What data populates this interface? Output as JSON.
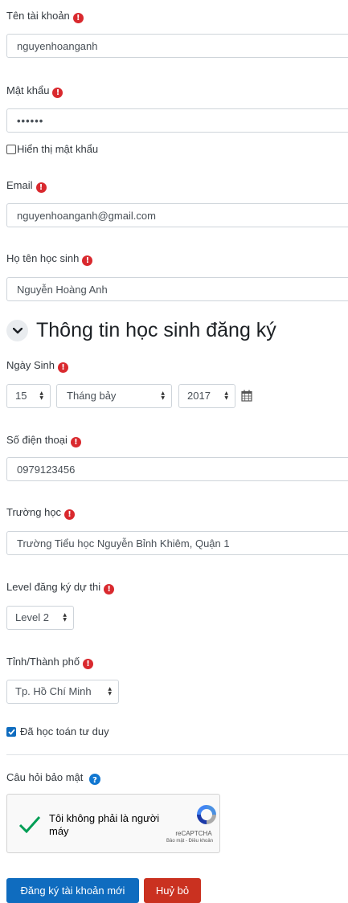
{
  "fields": {
    "username": {
      "label": "Tên tài khoản",
      "value": "nguyenhoanganh"
    },
    "password": {
      "label": "Mật khẩu",
      "value": "••••••",
      "show_label": "Hiển thị mật khẩu"
    },
    "email": {
      "label": "Email",
      "value": "nguyenhoanganh@gmail.com"
    },
    "student_name": {
      "label": "Họ tên học sinh",
      "value": "Nguyễn Hoàng Anh"
    }
  },
  "student_section": {
    "title": "Thông tin học sinh đăng ký",
    "birthdate": {
      "label": "Ngày Sinh",
      "day": "15",
      "month": "Tháng bảy",
      "year": "2017"
    },
    "phone": {
      "label": "Số điện thoại",
      "value": "0979123456"
    },
    "school": {
      "label": "Trường học",
      "value": "Trường Tiểu học Nguyễn Bỉnh Khiêm, Quận 1"
    },
    "level": {
      "label": "Level đăng ký dự thi",
      "value": "Level 2"
    },
    "city": {
      "label": "Tỉnh/Thành phố",
      "value": "Tp. Hồ Chí Minh"
    },
    "studied_math": {
      "label": "Đã học toán tư duy",
      "checked": true
    }
  },
  "security": {
    "label": "Câu hỏi bảo mật",
    "captcha_text": "Tôi không phải là người máy",
    "captcha_brand": "reCAPTCHA",
    "captcha_links": "Bảo mật - Điều khoản"
  },
  "actions": {
    "submit": "Đăng ký tài khoản mới",
    "cancel": "Huỷ bỏ"
  },
  "colors": {
    "required": "#d9292e",
    "primary": "#0f6cbf",
    "danger": "#ca3120",
    "help": "#1177d1"
  },
  "icons": {
    "required": "exclamation-circle-icon",
    "calendar": "calendar-icon",
    "help": "question-circle-icon",
    "chevron": "chevron-down-icon"
  }
}
